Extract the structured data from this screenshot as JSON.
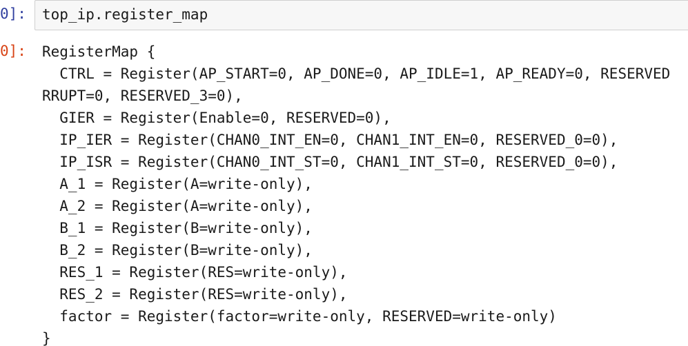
{
  "input_cell": {
    "prompt": "0]:",
    "code": "top_ip.register_map"
  },
  "output_cell": {
    "prompt": "0]:",
    "lines": [
      "RegisterMap {",
      "  CTRL = Register(AP_START=0, AP_DONE=0, AP_IDLE=1, AP_READY=0, RESERVED",
      "RRUPT=0, RESERVED_3=0),",
      "  GIER = Register(Enable=0, RESERVED=0),",
      "  IP_IER = Register(CHAN0_INT_EN=0, CHAN1_INT_EN=0, RESERVED_0=0),",
      "  IP_ISR = Register(CHAN0_INT_ST=0, CHAN1_INT_ST=0, RESERVED_0=0),",
      "  A_1 = Register(A=write-only),",
      "  A_2 = Register(A=write-only),",
      "  B_1 = Register(B=write-only),",
      "  B_2 = Register(B=write-only),",
      "  RES_1 = Register(RES=write-only),",
      "  RES_2 = Register(RES=write-only),",
      "  factor = Register(factor=write-only, RESERVED=write-only)",
      "}"
    ]
  }
}
